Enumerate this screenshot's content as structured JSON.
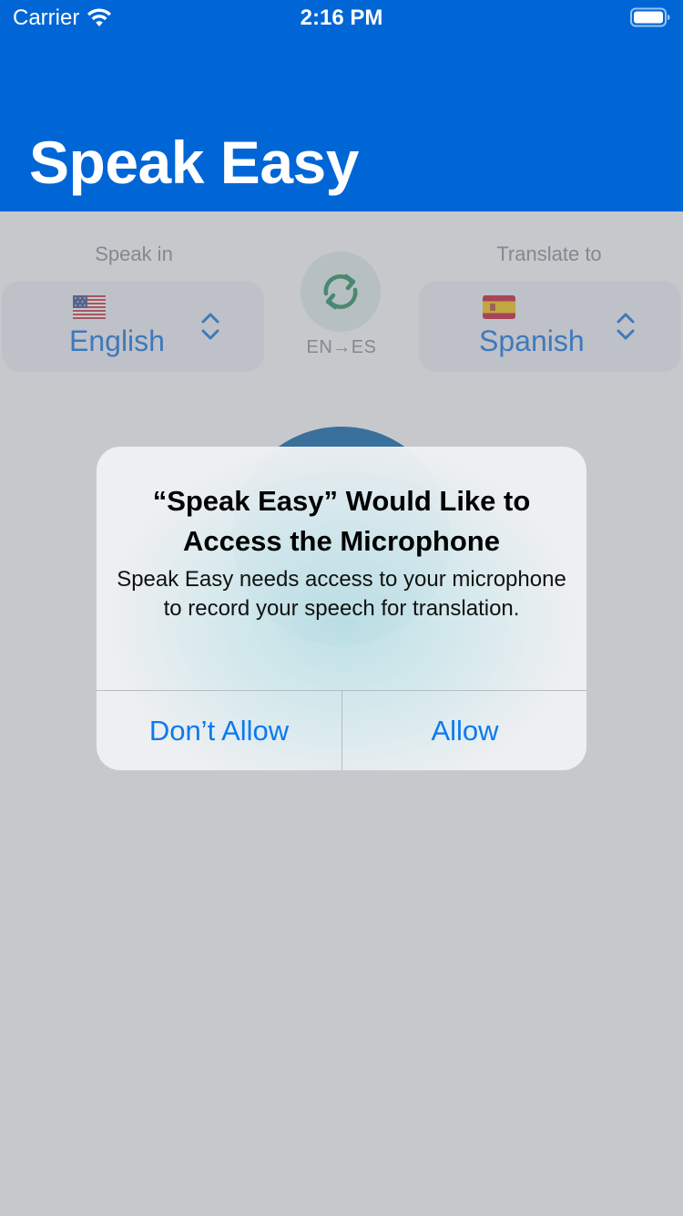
{
  "status_bar": {
    "carrier": "Carrier",
    "time": "2:16 PM"
  },
  "header": {
    "title": "Speak Easy",
    "background_color": "#0066d6"
  },
  "translator": {
    "source": {
      "label": "Speak in",
      "flag_icon": "us-flag-icon",
      "language": "English"
    },
    "target": {
      "label": "Translate to",
      "flag_icon": "spain-flag-icon",
      "language": "Spanish"
    },
    "swap": {
      "icon": "swap-arrows-icon",
      "pair_label": "EN→ES"
    }
  },
  "alert": {
    "title": "“Speak Easy” Would Like to Access the Microphone",
    "message": "Speak Easy needs access to your microphone to record your speech for translation.",
    "dont_allow_label": "Don’t Allow",
    "allow_label": "Allow",
    "button_color": "#0a7af0"
  }
}
